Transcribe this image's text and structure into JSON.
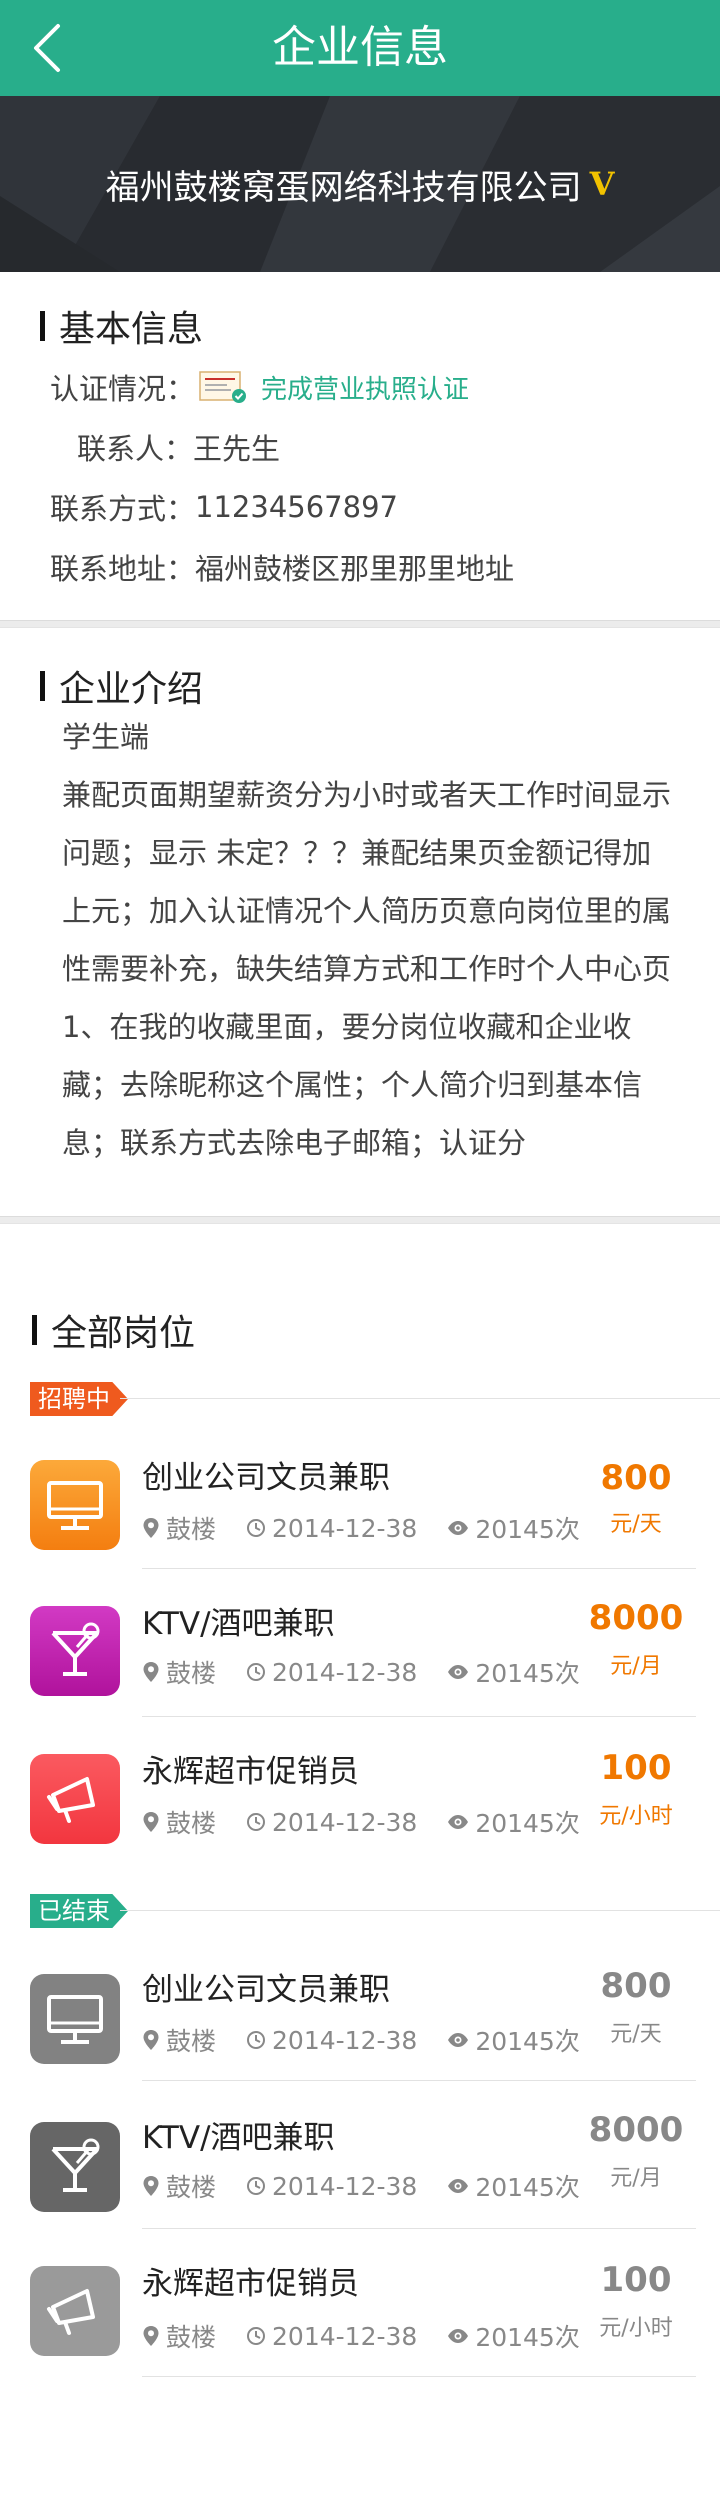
{
  "header": {
    "title": "企业信息",
    "back_icon": "chevron-left-icon"
  },
  "banner": {
    "company_name": "福州鼓楼窝蛋网络科技有限公司",
    "verified_badge": "V"
  },
  "basic_info": {
    "title": "基本信息",
    "cert_label": "认证情况：",
    "cert_status": "完成营业执照认证",
    "contact_label": "联系人：",
    "contact_value": "王先生",
    "phone_label": "联系方式：",
    "phone_value": "11234567897",
    "address_label": "联系地址：",
    "address_value": "福州鼓楼区那里那里地址"
  },
  "intro": {
    "title": "企业介绍",
    "subtitle": "学生端",
    "body": "兼配页面期望薪资分为小时或者天工作时间显示问题；显示 未定？？？兼配结果页金额记得加上元；加入认证情况个人简历页意向岗位里的属性需要补充，缺失结算方式和工作时个人中心页1、在我的收藏里面，要分岗位收藏和企业收藏；去除昵称这个属性；个人简介归到基本信息；联系方式去除电子邮箱；认证分"
  },
  "jobs_section": {
    "title": "全部岗位",
    "active_tag": "招聘中",
    "ended_tag": "已结束",
    "active_jobs": [
      {
        "title": "创业公司文员兼职",
        "location": "鼓楼",
        "date": "2014-12-38",
        "views": "20145次",
        "price": "800",
        "unit": "元/天",
        "icon": "monitor-icon"
      },
      {
        "title": "KTV/酒吧兼职",
        "location": "鼓楼",
        "date": "2014-12-38",
        "views": "20145次",
        "price": "8000",
        "unit": "元/月",
        "icon": "cocktail-icon"
      },
      {
        "title": "永辉超市促销员",
        "location": "鼓楼",
        "date": "2014-12-38",
        "views": "20145次",
        "price": "100",
        "unit": "元/小时",
        "icon": "megaphone-icon"
      }
    ],
    "ended_jobs": [
      {
        "title": "创业公司文员兼职",
        "location": "鼓楼",
        "date": "2014-12-38",
        "views": "20145次",
        "price": "800",
        "unit": "元/天",
        "icon": "monitor-icon"
      },
      {
        "title": "KTV/酒吧兼职",
        "location": "鼓楼",
        "date": "2014-12-38",
        "views": "20145次",
        "price": "8000",
        "unit": "元/月",
        "icon": "cocktail-icon"
      },
      {
        "title": "永辉超市促销员",
        "location": "鼓楼",
        "date": "2014-12-38",
        "views": "20145次",
        "price": "100",
        "unit": "元/小时",
        "icon": "megaphone-icon"
      }
    ]
  },
  "colors": {
    "primary": "#28ae8b",
    "active_tag": "#ef5a1e",
    "price": "#f07800",
    "ended": "#888888",
    "icon_orange": "#f7921c",
    "icon_magenta": "#c21fae",
    "icon_red": "#f7444e"
  }
}
